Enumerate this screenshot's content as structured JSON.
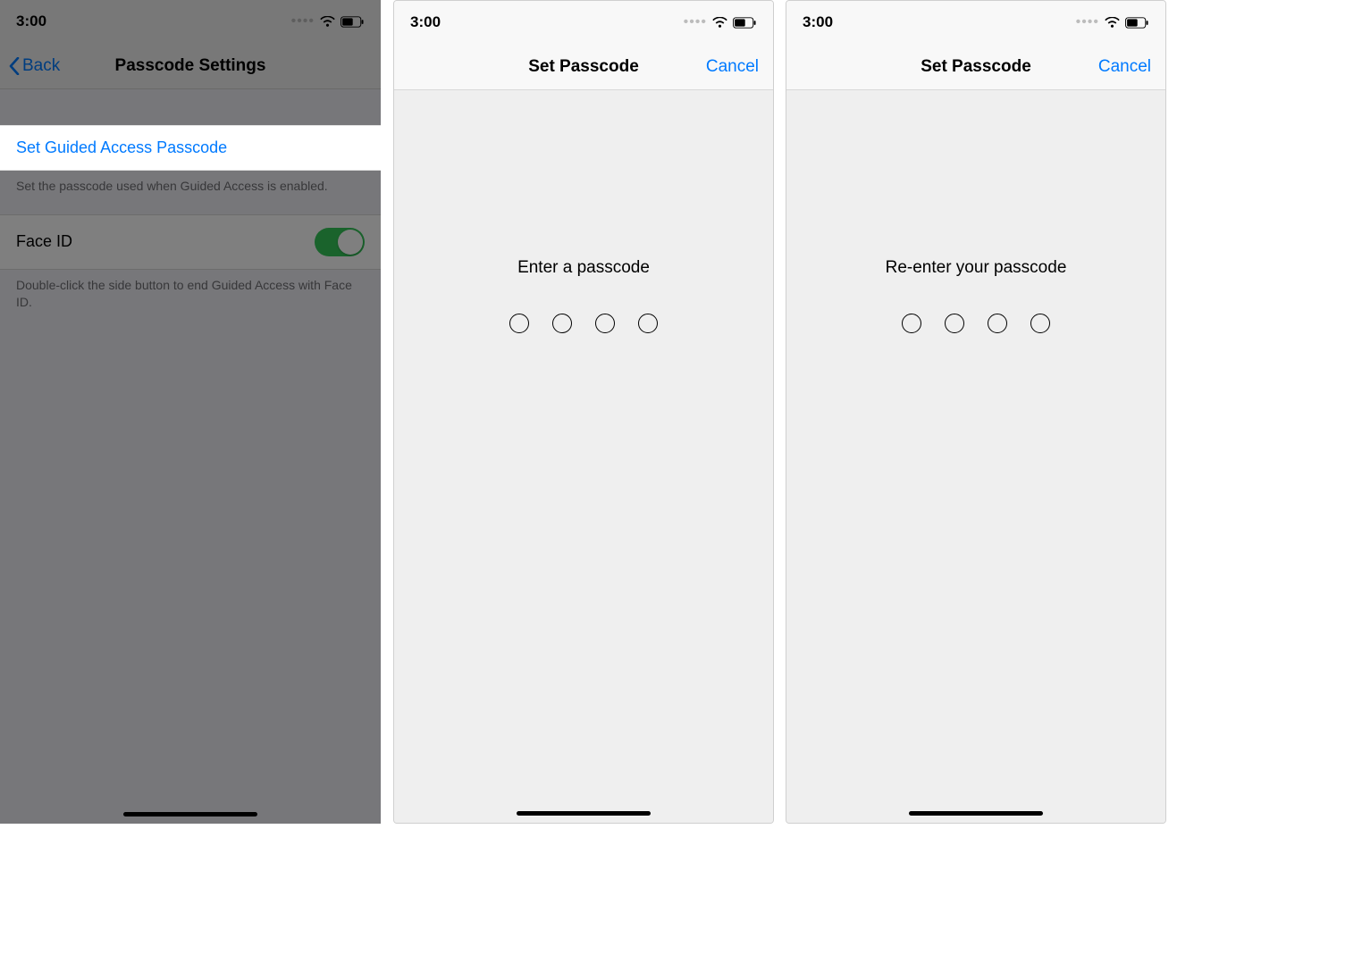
{
  "statusbar": {
    "time": "3:00"
  },
  "screen1": {
    "back_label": "Back",
    "title": "Passcode Settings",
    "set_link": "Set Guided Access Passcode",
    "set_note": "Set the passcode used when Guided Access is enabled.",
    "faceid_label": "Face ID",
    "faceid_note": "Double-click the side button to end Guided Access with Face ID."
  },
  "screen2": {
    "title": "Set Passcode",
    "cancel": "Cancel",
    "prompt": "Enter a passcode"
  },
  "screen3": {
    "title": "Set Passcode",
    "cancel": "Cancel",
    "prompt": "Re-enter your passcode"
  }
}
